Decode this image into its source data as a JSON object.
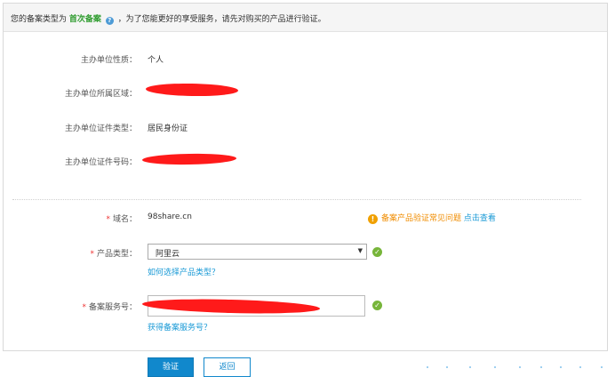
{
  "notice": {
    "prefix": "您的备案类型为",
    "type": "首次备案",
    "help_glyph": "?",
    "suffix": "，为了您能更好的享受服务，请先对购买的产品进行验证。"
  },
  "sponsor": {
    "nature_label": "主办单位性质：",
    "nature_value": "个人",
    "region_label": "主办单位所属区域：",
    "id_type_label": "主办单位证件类型：",
    "id_type_value": "居民身份证",
    "id_number_label": "主办单位证件号码："
  },
  "form": {
    "required_mark": "*",
    "domain_label": "域名：",
    "domain_value": "98share.cn",
    "faq_icon": "!",
    "faq_text": "备案产品验证常见问题",
    "faq_link": "点击查看",
    "product_type_label": "产品类型：",
    "product_type_value": "阿里云",
    "select_arrow": "▼",
    "product_type_help": "如何选择产品类型？",
    "service_no_label": "备案服务号：",
    "service_no_help": "获得备案服务号？",
    "check_glyph": "✓"
  },
  "buttons": {
    "verify": "验证",
    "back": "返回"
  },
  "colors": {
    "accent": "#1188cc",
    "highlight": "#2d9b2d",
    "warning": "#f08c00",
    "success": "#77b53a",
    "redaction": "#ff1a1a"
  }
}
